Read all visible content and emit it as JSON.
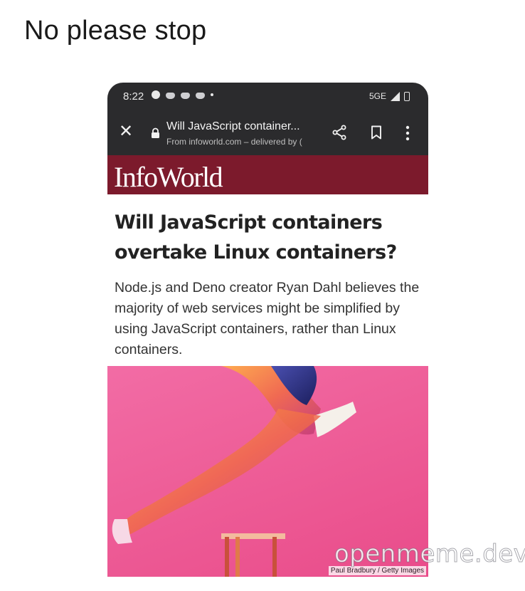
{
  "post": {
    "caption": "No please stop"
  },
  "status_bar": {
    "time": "8:22",
    "network": "5GE"
  },
  "browser_tab": {
    "title": "Will JavaScript container...",
    "subtitle": "From infoworld.com – delivered by (",
    "icons": [
      "close-icon",
      "lock-icon",
      "share-icon",
      "bookmark-icon",
      "more-vert-icon"
    ]
  },
  "article": {
    "brand": "InfoWorld",
    "headline": "Will JavaScript containers overtake Linux containers?",
    "summary": "Node.js and Deno creator Ryan Dahl believes the majority of web services might be simplified by using JavaScript containers, rather than Linux containers.",
    "image_credit": "Paul Bradbury / Getty Images"
  },
  "watermark": "openmeme.dev",
  "colors": {
    "brand_bar": "#7c1a2c",
    "chrome_bar": "#2b2b2d",
    "hero_pink": "#ee5e98"
  }
}
